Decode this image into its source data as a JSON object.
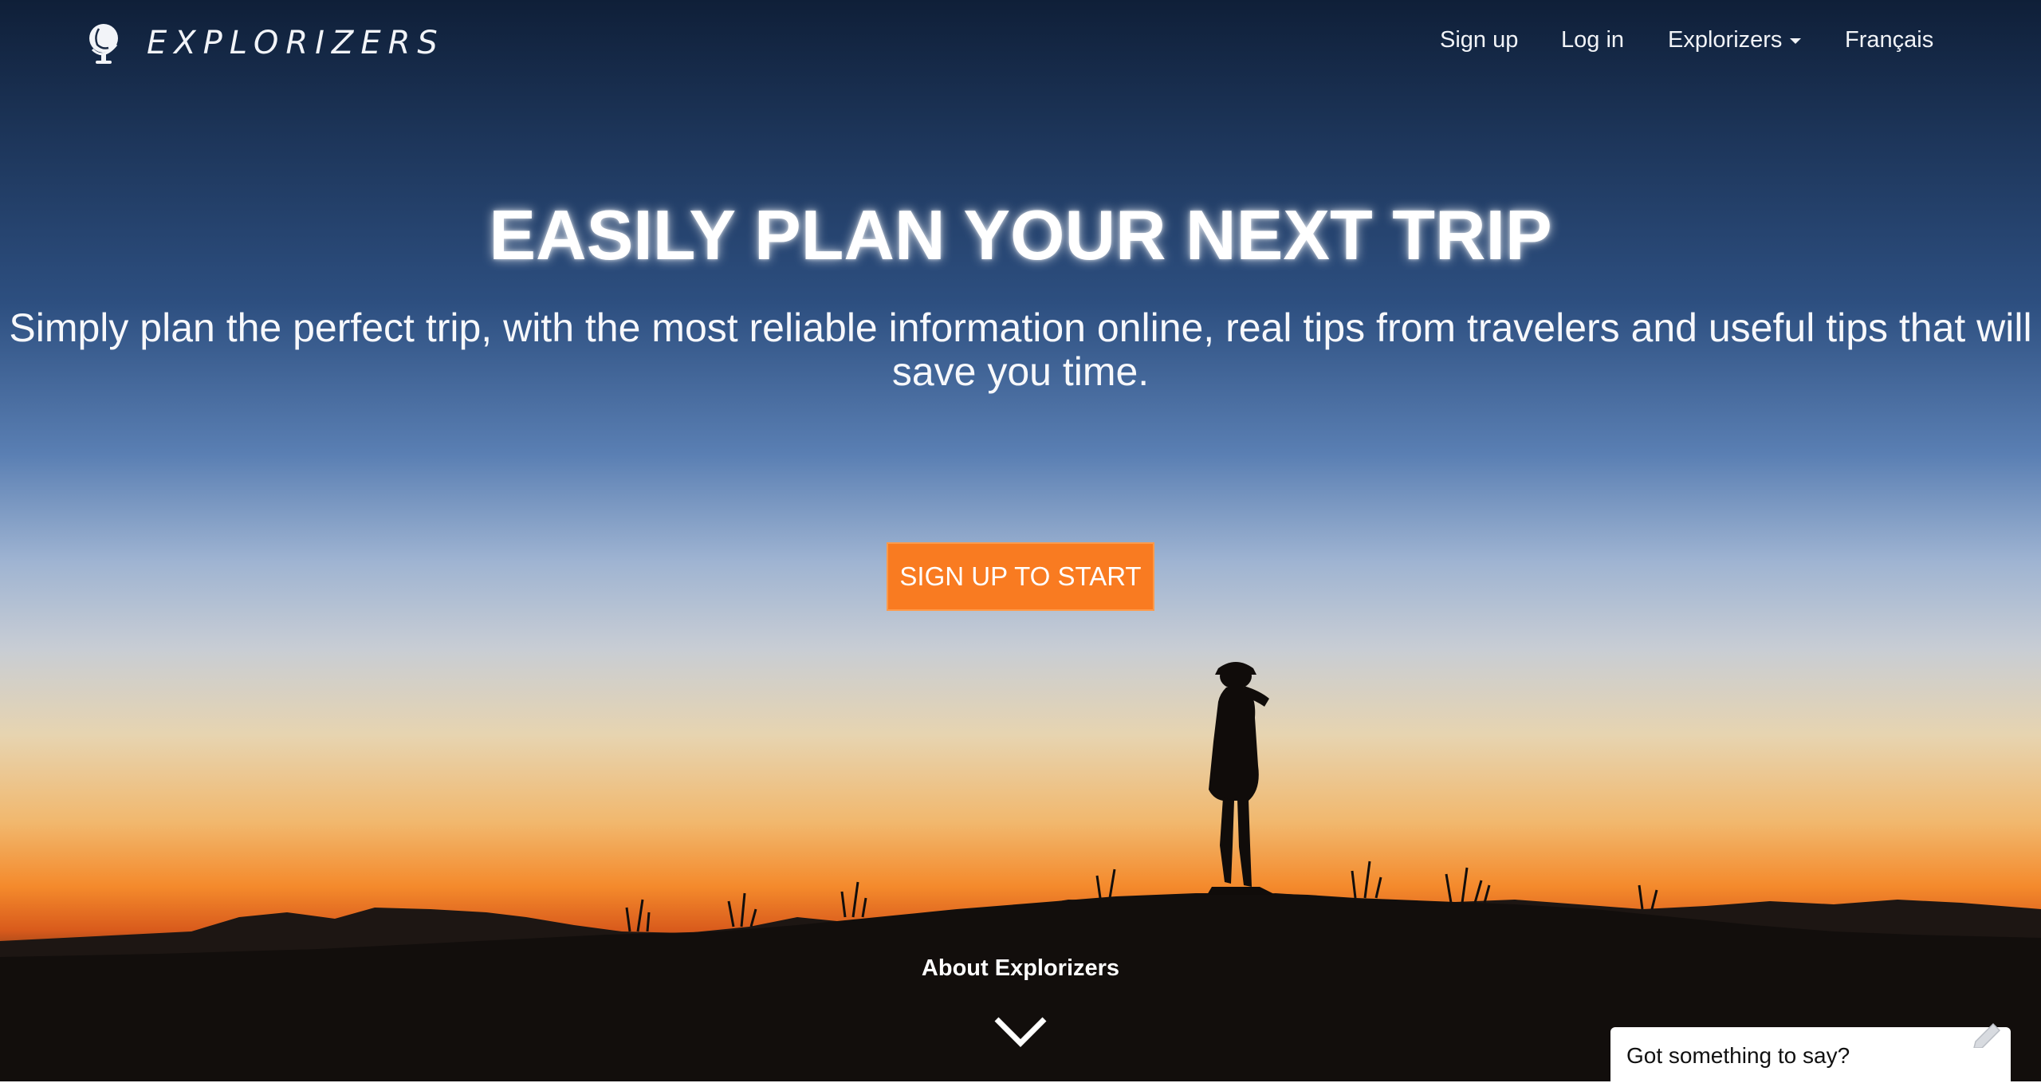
{
  "brand": {
    "name": "EXPLORIZERS",
    "logo_icon": "globe-icon"
  },
  "nav": {
    "signup": "Sign up",
    "login": "Log in",
    "explorizers": "Explorizers",
    "language": "Français"
  },
  "hero": {
    "headline": "EASILY PLAN YOUR NEXT TRIP",
    "subline": "Simply plan the perfect trip, with the most reliable information online, real tips from travelers and useful tips that will save you time.",
    "cta": "SIGN UP TO START"
  },
  "about": {
    "label": "About Explorizers",
    "icon": "chevron-down-icon"
  },
  "feedback": {
    "label": "Got something to say?",
    "icon": "pencil-icon"
  },
  "colors": {
    "cta": "#f97b21",
    "sky_top": "#0f1f38",
    "horizon": "#f48a2c"
  }
}
